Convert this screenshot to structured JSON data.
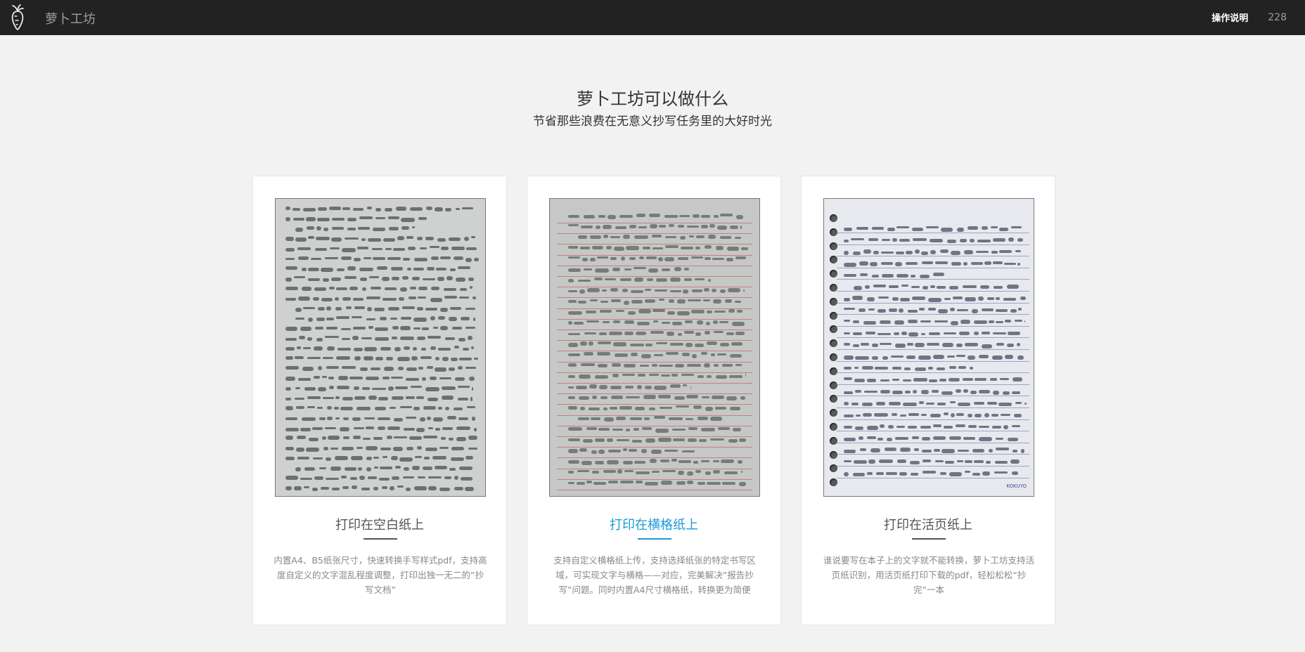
{
  "navbar": {
    "brand": "萝卜工坊",
    "logo_icon": "carrot-icon",
    "help_link": "操作说明",
    "count": "228",
    "bg_color": "#222222"
  },
  "hero": {
    "title": "萝卜工坊可以做什么",
    "subtitle": "节省那些浪费在无意义抄写任务里的大好时光"
  },
  "cards": [
    {
      "title": "打印在空白纸上",
      "description": "内置A4、B5纸张尺寸，快速转换手写样式pdf，支持高度自定义的文字混乱程度调整，打印出独一无二的“抄写文档”",
      "active": false
    },
    {
      "title": "打印在横格纸上",
      "description": "支持自定义横格纸上传，支持选择纸张的特定书写区域，可实现文字与横格——对应，完美解决“报告抄写”问题。同时内置A4尺寸横格纸，转换更为简便",
      "active": true
    },
    {
      "title": "打印在活页纸上",
      "description": "谁说要写在本子上的文字就不能转换，萝卜工坊支持活页纸识别，用活页纸打印下载的pdf，轻松松松“抄完”一本",
      "active": false
    }
  ],
  "colors": {
    "accent": "#1a9bd7",
    "page_bg": "#f2f2f2"
  }
}
